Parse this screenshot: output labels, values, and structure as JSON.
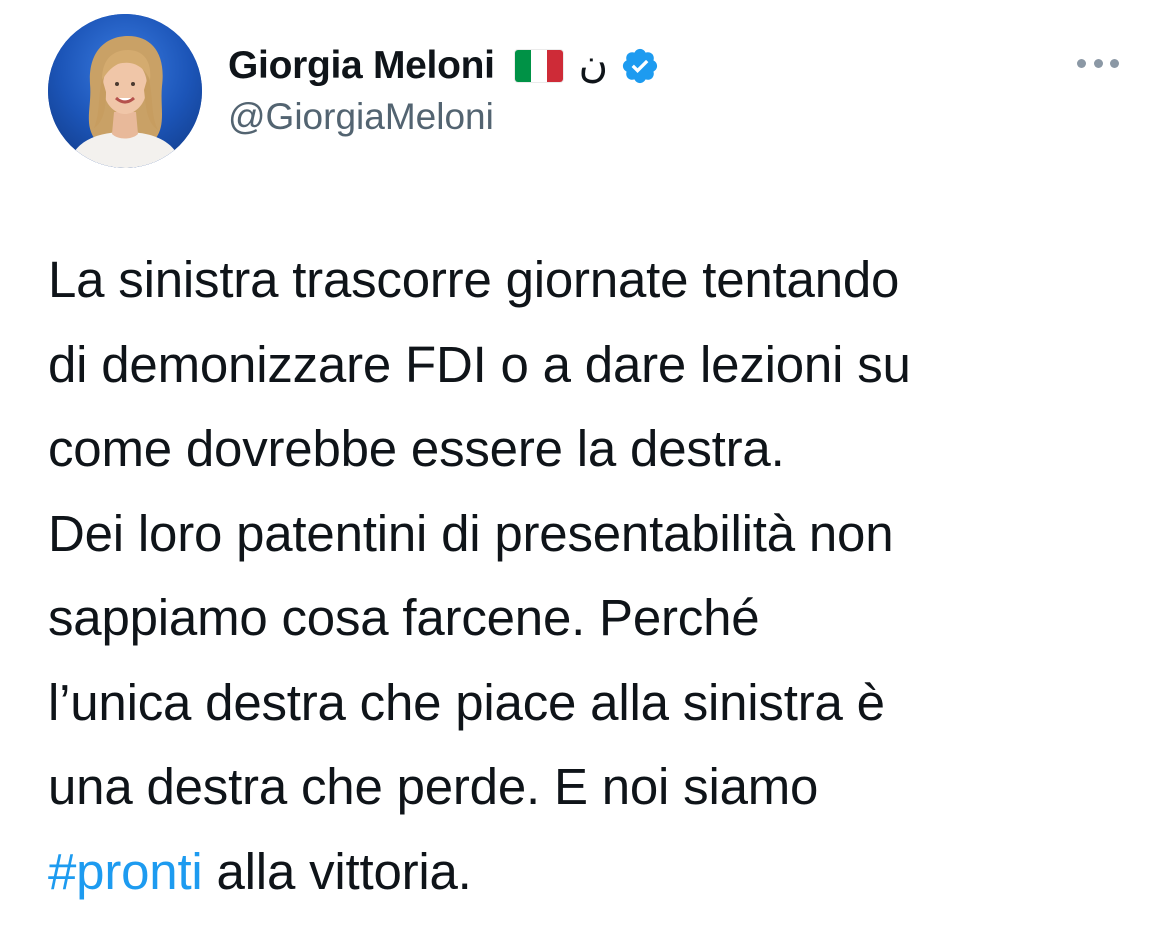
{
  "author": {
    "display_name": "Giorgia Meloni",
    "flag_emoji_name": "italy-flag",
    "flag_colors": [
      "#009246",
      "#ffffff",
      "#ce2b37"
    ],
    "extra_glyph": "ن",
    "verified": true,
    "verified_color": "#1d9bf0",
    "handle": "@GiorgiaMeloni"
  },
  "tweet": {
    "lines": [
      "La sinistra trascorre giornate tentando",
      "di demonizzare FDI o a dare lezioni su",
      "come dovrebbe essere la destra.",
      "Dei loro patentini di presentabilità non",
      "sappiamo cosa farcene. Perché",
      "l’unica destra che piace alla sinistra è",
      "una destra che perde. E noi siamo"
    ],
    "last_line": {
      "hashtag": "#pronti",
      "rest": " alla vittoria."
    },
    "hashtag_color": "#1d9bf0"
  },
  "icons": {
    "more": "more-options-icon",
    "verified": "verified-badge-icon"
  }
}
